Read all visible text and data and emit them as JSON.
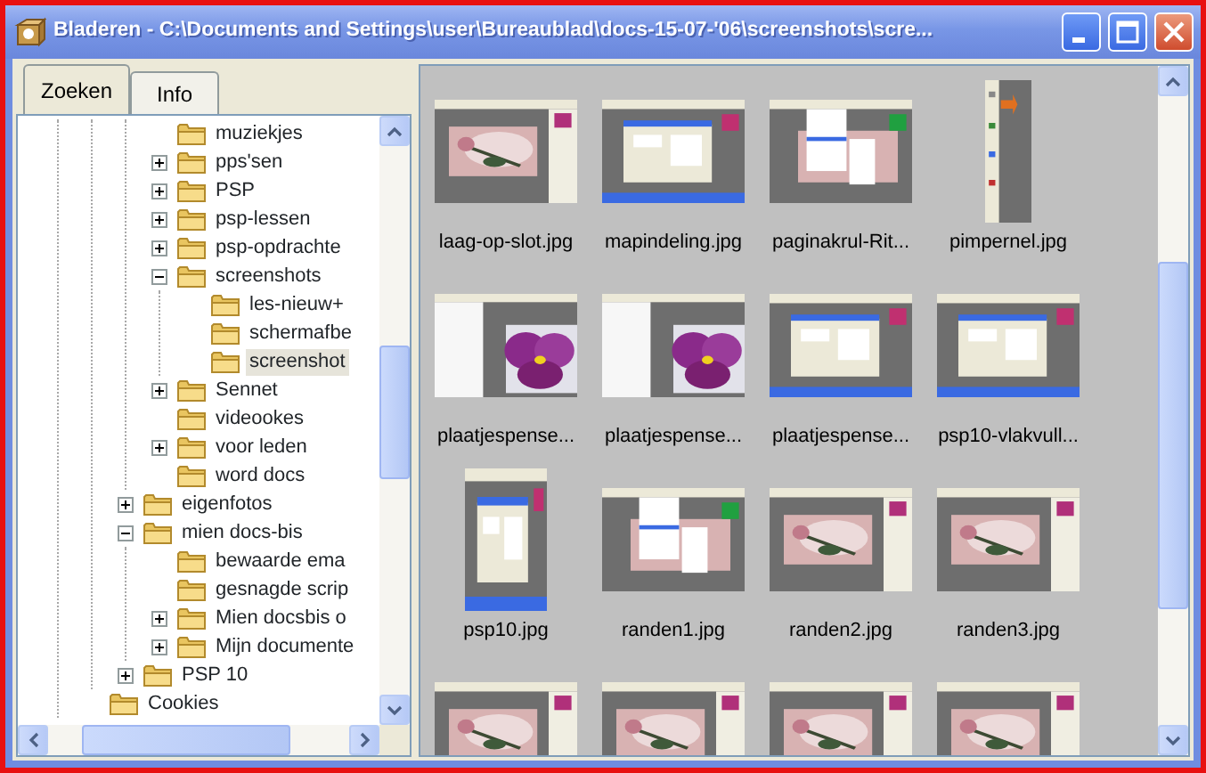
{
  "window": {
    "title": "Bladeren - C:\\Documents and Settings\\user\\Bureaublad\\docs-15-07-'06\\screenshots\\scre..."
  },
  "tabs": [
    {
      "label": "Zoeken",
      "selected": true
    },
    {
      "label": "Info",
      "selected": false
    }
  ],
  "tree": [
    {
      "children": [
        {
          "children": [
            {
              "children": [
                {
                  "label": "muziekjes",
                  "selected": false
                },
                {
                  "label": "pps'sen",
                  "expanded": false,
                  "selected": false
                },
                {
                  "label": "PSP",
                  "expanded": false,
                  "selected": false
                },
                {
                  "label": "psp-lessen",
                  "expanded": false,
                  "selected": false
                },
                {
                  "label": "psp-opdrachte",
                  "expanded": false,
                  "selected": false
                },
                {
                  "label": "screenshots",
                  "expanded": true,
                  "selected": false,
                  "children": [
                    {
                      "label": "les-nieuw+",
                      "selected": false
                    },
                    {
                      "label": "schermafbe",
                      "selected": false
                    },
                    {
                      "label": "screenshot",
                      "selected": true
                    }
                  ]
                },
                {
                  "label": "Sennet",
                  "expanded": false,
                  "selected": false
                },
                {
                  "label": "videookes",
                  "selected": false
                },
                {
                  "label": "voor leden",
                  "expanded": false,
                  "selected": false
                },
                {
                  "label": "word docs",
                  "selected": false
                }
              ]
            },
            {
              "label": "eigenfotos",
              "expanded": false,
              "selected": false
            },
            {
              "label": "mien docs-bis",
              "expanded": true,
              "selected": false,
              "children": [
                {
                  "label": "bewaarde ema",
                  "selected": false
                },
                {
                  "label": "gesnagde scrip",
                  "selected": false
                },
                {
                  "label": "Mien docsbis o",
                  "expanded": false,
                  "selected": false
                },
                {
                  "label": "Mijn documente",
                  "expanded": false,
                  "selected": false
                }
              ]
            },
            {
              "label": "PSP 10",
              "expanded": false,
              "selected": false
            }
          ]
        },
        {
          "label": "Cookies",
          "selected": false
        }
      ]
    }
  ],
  "thumbnails": [
    {
      "label": "laag-op-slot.jpg",
      "kind": "picture"
    },
    {
      "label": "mapindeling.jpg",
      "kind": "picture"
    },
    {
      "label": "paginakrul-Rit...",
      "kind": "picture"
    },
    {
      "label": "pimpernel.jpg",
      "kind": "picture"
    },
    {
      "label": "plaatjespense...",
      "kind": "picture"
    },
    {
      "label": "plaatjespense...",
      "kind": "picture"
    },
    {
      "label": "plaatjespense...",
      "kind": "picture"
    },
    {
      "label": "psp10-vlakvull...",
      "kind": "picture"
    },
    {
      "label": "psp10.jpg",
      "kind": "picture"
    },
    {
      "label": "randen1.jpg",
      "kind": "picture"
    },
    {
      "label": "randen2.jpg",
      "kind": "picture"
    },
    {
      "label": "randen3.jpg",
      "kind": "picture"
    },
    {
      "kind": "picture"
    },
    {
      "kind": "picture"
    },
    {
      "kind": "picture"
    },
    {
      "kind": "picture"
    }
  ]
}
